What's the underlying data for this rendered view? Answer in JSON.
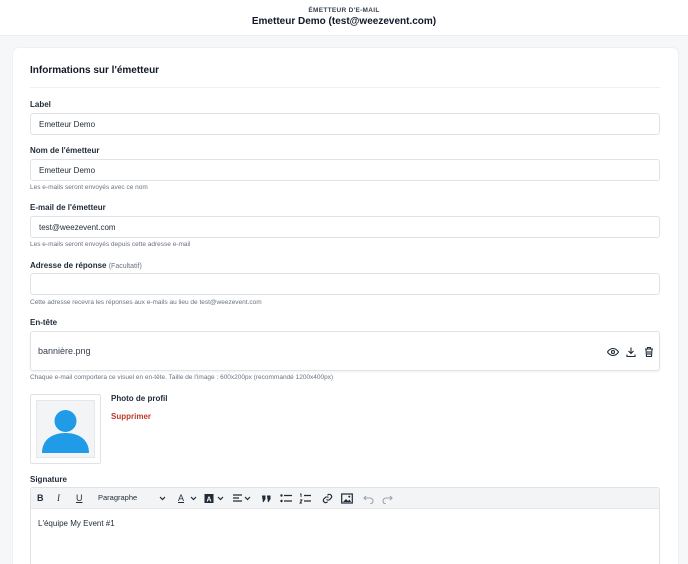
{
  "topbar": {
    "kicker": "ÉMETTEUR D'E-MAIL",
    "title": "Emetteur Demo (test@weezevent.com)"
  },
  "card": {
    "title": "Informations sur l'émetteur"
  },
  "fields": {
    "label": {
      "label": "Label",
      "value": "Emetteur Demo"
    },
    "sender_name": {
      "label": "Nom de l'émetteur",
      "value": "Emetteur Demo",
      "help": "Les e-mails seront envoyés avec ce nom"
    },
    "sender_email": {
      "label": "E-mail de l'émetteur",
      "value": "test@weezevent.com",
      "help": "Les e-mails seront envoyés depuis cette adresse e-mail"
    },
    "reply_to": {
      "label": "Adresse de réponse",
      "optional": "(Facultatif)",
      "value": "",
      "help": "Cette adresse recevra les réponses aux e-mails au lieu de test@weezevent.com"
    }
  },
  "header_image": {
    "label": "En-tête",
    "filename": "bannière.png",
    "help": "Chaque e-mail comportera ce visuel en en-tête. Taille de l'image : 600x200px (recommandé 1200x400px)",
    "icons": [
      "eye-icon",
      "download-icon",
      "trash-icon"
    ]
  },
  "profile": {
    "label": "Photo de profil",
    "delete_label": "Supprimer"
  },
  "signature": {
    "label": "Signature",
    "paragraph_style": "Paragraphe",
    "content": "L'équipe My Event #1",
    "toolbar_icons": [
      "bold-icon",
      "italic-icon",
      "underline-icon",
      "font-color-icon",
      "highlight-icon",
      "align-icon",
      "quote-icon",
      "bullet-list-icon",
      "numbered-list-icon",
      "link-icon",
      "image-icon",
      "undo-icon",
      "redo-icon"
    ]
  },
  "colors": {
    "accent_blue": "#1f9be8",
    "danger": "#c0392b",
    "text": "#1f2a37",
    "muted": "#6b7280"
  }
}
